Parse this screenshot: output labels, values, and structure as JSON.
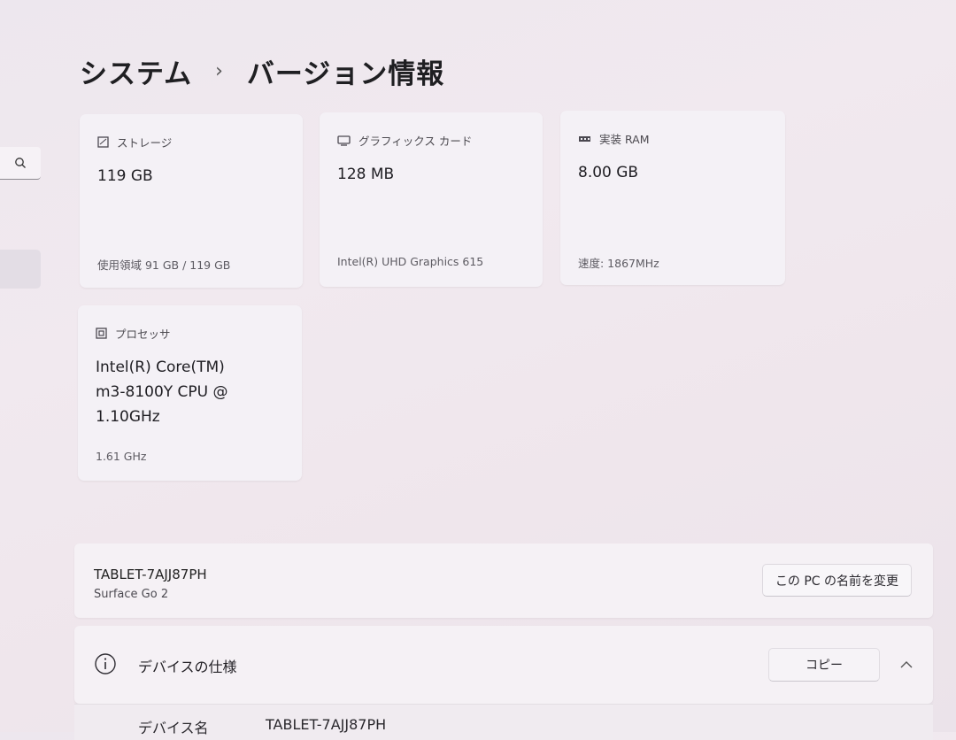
{
  "breadcrumb": {
    "parent": "システム",
    "separator": "›",
    "current": "バージョン情報"
  },
  "cards": {
    "storage": {
      "label": "ストレージ",
      "value": "119 GB",
      "sub": "使用領域 91 GB / 119 GB",
      "icon": "drive-icon"
    },
    "graphics": {
      "label": "グラフィックス カード",
      "value": "128 MB",
      "sub": "Intel(R) UHD Graphics 615",
      "icon": "display-icon"
    },
    "ram": {
      "label": "実装 RAM",
      "value": "8.00 GB",
      "sub": "速度: 1867MHz",
      "icon": "memory-icon"
    },
    "processor": {
      "label": "プロセッサ",
      "value_lines": [
        "Intel(R) Core(TM)",
        "m3-8100Y CPU @",
        "1.10GHz"
      ],
      "sub": "1.61 GHz",
      "icon": "cpu-icon"
    }
  },
  "device": {
    "name": "TABLET-7AJJ87PH",
    "model": "Surface Go 2",
    "rename_label": "この PC の名前を変更"
  },
  "specs": {
    "title": "デバイスの仕様",
    "copy_label": "コピー",
    "rows": [
      {
        "label": "デバイス名",
        "value": "TABLET-7AJJ87PH"
      }
    ]
  },
  "colors": {
    "background": "#efe7ee",
    "card": "#f4f1f6",
    "text": "#1f1f22"
  }
}
